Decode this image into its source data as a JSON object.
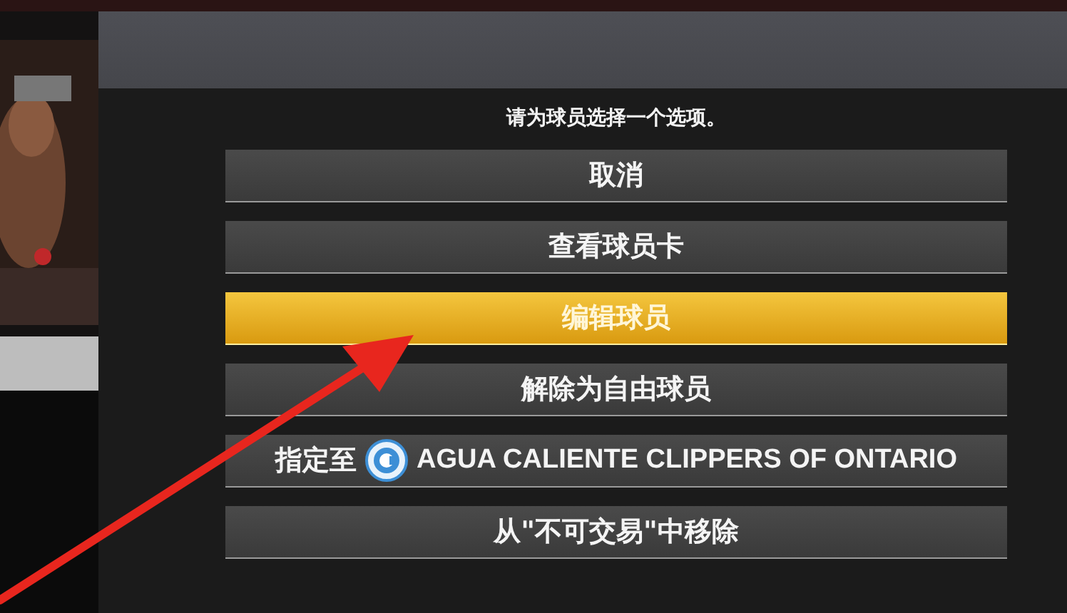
{
  "dialog": {
    "prompt": "请为球员选择一个选项。",
    "options": [
      {
        "kind": "plain",
        "label": "取消",
        "selected": false
      },
      {
        "kind": "plain",
        "label": "查看球员卡",
        "selected": false
      },
      {
        "kind": "plain",
        "label": "编辑球员",
        "selected": true
      },
      {
        "kind": "plain",
        "label": "解除为自由球员",
        "selected": false
      },
      {
        "kind": "team",
        "label": "指定至",
        "team": "AGUA CALIENTE CLIPPERS OF ONTARIO",
        "selected": false
      },
      {
        "kind": "plain",
        "label": "从\"不可交易\"中移除",
        "selected": false
      }
    ]
  }
}
